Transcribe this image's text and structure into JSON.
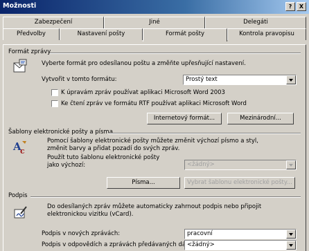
{
  "window": {
    "title": "Možnosti",
    "help_label": "?",
    "close_label": "X"
  },
  "tabs_top": [
    "Zabezpečení",
    "Jiné",
    "Delegáti"
  ],
  "tabs_bottom": [
    "Předvolby",
    "Nastavení pošty",
    "Formát pošty",
    "Kontrola pravopisu"
  ],
  "format_section": {
    "heading": "Formát zprávy",
    "description": "Vyberte formát pro odesílanou poštu a změňte upřesňující nastavení.",
    "compose_label": "Vytvořit v tomto formátu:",
    "compose_value": "Prostý text",
    "checkbox1": "K úpravám zpráv používat aplikaci Microsoft Word 2003",
    "checkbox2": "Ke čtení zpráv ve formátu RTF používat aplikaci Microsoft Word",
    "internet_button": "Internetový formát...",
    "international_button": "Mezinárodní..."
  },
  "stationery_section": {
    "heading": "Šablony elektronické pošty a písma",
    "description_line1": "Pomocí šablony elektronické pošty můžete změnit výchozí písmo a styl,",
    "description_line2": "změnit barvy a přidat pozadí do svých zpráv.",
    "use_label_line1": "Použít tuto šablonu elektronické pošty",
    "use_label_line2": "jako výchozí:",
    "stationery_value": "<žádný>",
    "fonts_button": "Písma...",
    "pick_button": "Vybrat šablonu elektronické pošty..."
  },
  "signature_section": {
    "heading": "Podpis",
    "description_line1": "Do odesílaných zpráv můžete automaticky zahrnout podpis nebo připojit",
    "description_line2": "elektronickou vizitku (vCard).",
    "new_label": "Podpis v nových zprávách:",
    "new_value": "pracovní",
    "reply_label": "Podpis v odpovědích a zprávách předávaných dál:",
    "reply_value": "<žádný>"
  }
}
